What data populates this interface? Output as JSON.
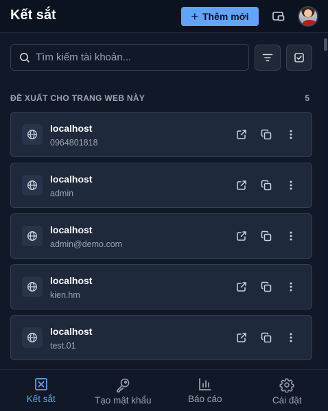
{
  "header": {
    "title": "Kết sắt",
    "add_button_label": "Thêm mới",
    "add_icon": "plus-icon",
    "window_icon": "popout-window-icon",
    "avatar": "user-avatar"
  },
  "search": {
    "placeholder": "Tìm kiếm tài khoản...",
    "value": "",
    "filter_icon": "filter-icon",
    "select_icon": "checkbox-select-icon"
  },
  "section": {
    "title": "ĐỀ XUẤT CHO TRANG WEB NÀY",
    "count": "5"
  },
  "items": [
    {
      "site": "localhost",
      "username": "0964801818"
    },
    {
      "site": "localhost",
      "username": "admin"
    },
    {
      "site": "localhost",
      "username": "admin@demo.com"
    },
    {
      "site": "localhost",
      "username": "kien.hm"
    },
    {
      "site": "localhost",
      "username": "test.01"
    }
  ],
  "item_actions": [
    "open-link-icon",
    "copy-icon",
    "more-vertical-icon"
  ],
  "nav": [
    {
      "label": "Kết sắt",
      "icon": "vault-icon",
      "active": true
    },
    {
      "label": "Tạo mật khẩu",
      "icon": "key-icon",
      "active": false
    },
    {
      "label": "Báo cáo",
      "icon": "bar-chart-icon",
      "active": false
    },
    {
      "label": "Cài đặt",
      "icon": "settings-gear-icon",
      "active": false
    }
  ],
  "colors": {
    "background": "#111827",
    "card": "#1e293b",
    "accent": "#60a5fa",
    "muted_text": "#9ca3af"
  }
}
